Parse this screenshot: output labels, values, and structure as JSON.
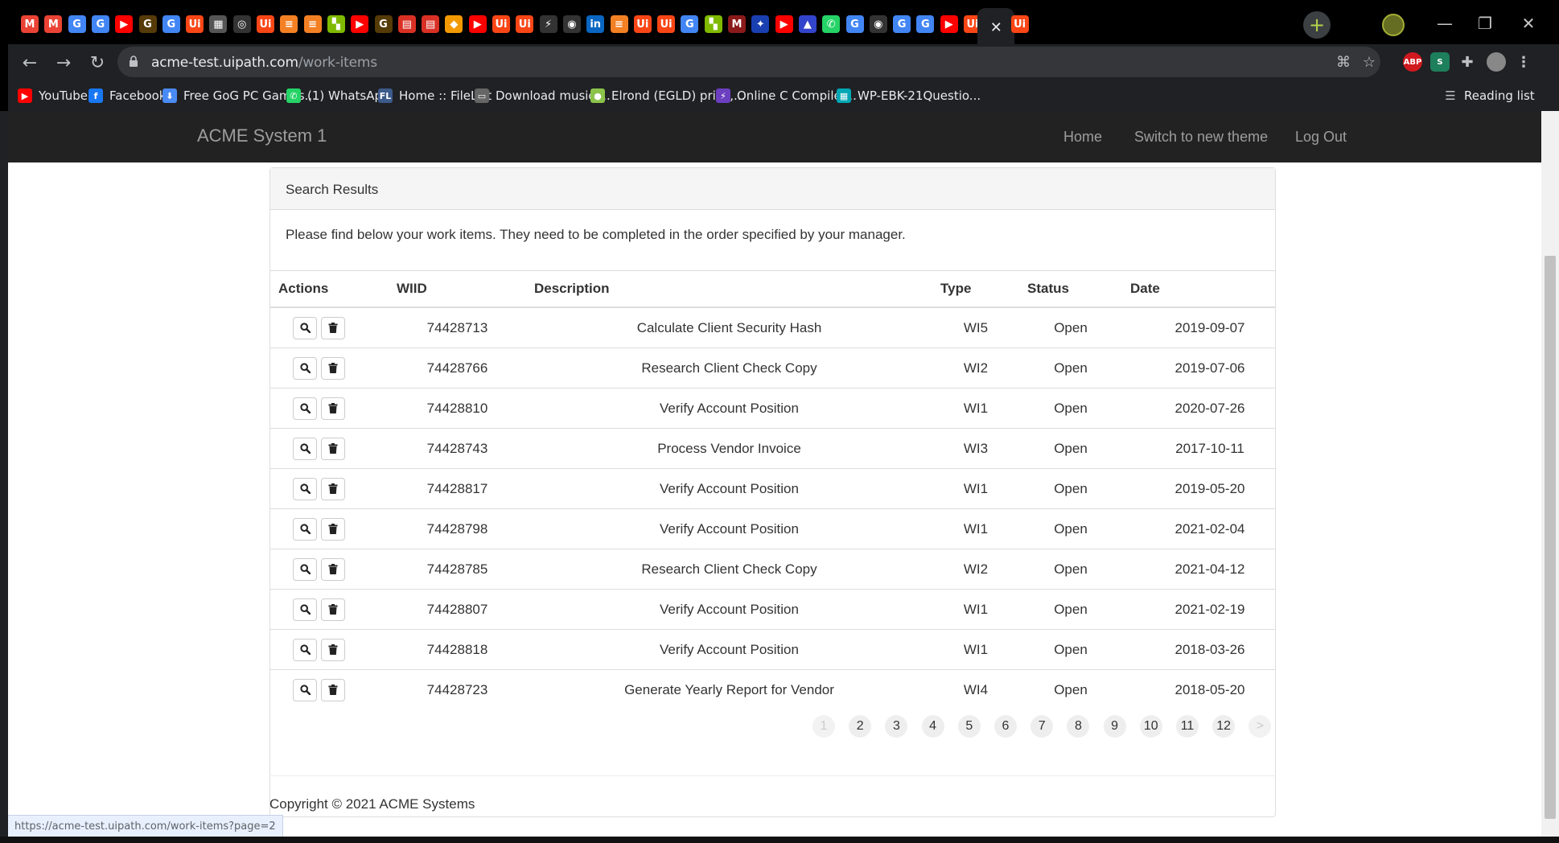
{
  "browser": {
    "tabs": [
      {
        "icon": "gmail-icon",
        "glyph": "M",
        "color": "#ea4335"
      },
      {
        "icon": "gmail-icon",
        "glyph": "M",
        "color": "#ea4335"
      },
      {
        "icon": "google-icon",
        "glyph": "G",
        "color": "#4285f4"
      },
      {
        "icon": "google-icon",
        "glyph": "G",
        "color": "#4285f4"
      },
      {
        "icon": "youtube-icon",
        "glyph": "▶",
        "color": "#ff0000"
      },
      {
        "icon": "goodreads-icon",
        "glyph": "G",
        "color": "#553b08"
      },
      {
        "icon": "google-icon",
        "glyph": "G",
        "color": "#4285f4"
      },
      {
        "icon": "uipath-icon",
        "glyph": "Ui",
        "color": "#fa4616"
      },
      {
        "icon": "calculator-icon",
        "glyph": "▦",
        "color": "#555555"
      },
      {
        "icon": "chatgpt-icon",
        "glyph": "◎",
        "color": "#333333"
      },
      {
        "icon": "uipath-icon",
        "glyph": "Ui",
        "color": "#fa4616"
      },
      {
        "icon": "stackoverflow-icon",
        "glyph": "≡",
        "color": "#f48024"
      },
      {
        "icon": "stackoverflow-icon",
        "glyph": "≡",
        "color": "#f48024"
      },
      {
        "icon": "microsoft-icon",
        "glyph": "▚",
        "color": "#7fba00"
      },
      {
        "icon": "youtube-icon",
        "glyph": "▶",
        "color": "#ff0000"
      },
      {
        "icon": "goodreads-icon",
        "glyph": "G",
        "color": "#553b08"
      },
      {
        "icon": "store-icon",
        "glyph": "▤",
        "color": "#d93025"
      },
      {
        "icon": "store-icon",
        "glyph": "▤",
        "color": "#d93025"
      },
      {
        "icon": "diamond-icon",
        "glyph": "◆",
        "color": "#f29900"
      },
      {
        "icon": "youtube-icon",
        "glyph": "▶",
        "color": "#ff0000"
      },
      {
        "icon": "uipath-icon",
        "glyph": "Ui",
        "color": "#fa4616"
      },
      {
        "icon": "uipath-icon",
        "glyph": "Ui",
        "color": "#fa4616"
      },
      {
        "icon": "bolt-icon",
        "glyph": "⚡",
        "color": "#333333"
      },
      {
        "icon": "github-icon",
        "glyph": "◉",
        "color": "#333333"
      },
      {
        "icon": "linkedin-icon",
        "glyph": "in",
        "color": "#0a66c2"
      },
      {
        "icon": "stackoverflow-icon",
        "glyph": "≡",
        "color": "#f48024"
      },
      {
        "icon": "uipath-icon",
        "glyph": "Ui",
        "color": "#fa4616"
      },
      {
        "icon": "uipath-icon",
        "glyph": "Ui",
        "color": "#fa4616"
      },
      {
        "icon": "google-icon",
        "glyph": "G",
        "color": "#4285f4"
      },
      {
        "icon": "microsoft-icon",
        "glyph": "▚",
        "color": "#7fba00"
      },
      {
        "icon": "mailchimp-icon",
        "glyph": "M",
        "color": "#8b1a1a"
      },
      {
        "icon": "bolt-icon",
        "glyph": "✦",
        "color": "#1a3fb0"
      },
      {
        "icon": "youtube-icon",
        "glyph": "▶",
        "color": "#ff0000"
      },
      {
        "icon": "triangle-icon",
        "glyph": "▲",
        "color": "#3344cc"
      },
      {
        "icon": "whatsapp-icon",
        "glyph": "✆",
        "color": "#25d366"
      },
      {
        "icon": "google-icon",
        "glyph": "G",
        "color": "#4285f4"
      },
      {
        "icon": "github-icon",
        "glyph": "◉",
        "color": "#333333"
      },
      {
        "icon": "google-icon",
        "glyph": "G",
        "color": "#4285f4"
      },
      {
        "icon": "google-icon",
        "glyph": "G",
        "color": "#4285f4"
      },
      {
        "icon": "youtube-icon",
        "glyph": "▶",
        "color": "#ff0000"
      },
      {
        "icon": "uipath-icon",
        "glyph": "Ui",
        "color": "#fa4616"
      },
      {
        "icon": "close-icon",
        "glyph": "✕",
        "color": "#e8eaed",
        "active": true
      },
      {
        "icon": "uipath-icon",
        "glyph": "Ui",
        "color": "#fa4616"
      }
    ],
    "url_host": "acme-test.uipath.com",
    "url_path": "/work-items",
    "bookmarks": [
      {
        "label": "YouTube",
        "icon": "youtube-icon",
        "glyph": "▶",
        "color": "#ff0000"
      },
      {
        "label": "Facebook",
        "icon": "facebook-icon",
        "glyph": "f",
        "color": "#1877f2"
      },
      {
        "label": "Free GoG PC Games...",
        "icon": "download-icon",
        "glyph": "⬇",
        "color": "#4a8af4"
      },
      {
        "label": "(1) WhatsApp",
        "icon": "whatsapp-icon",
        "glyph": "✆",
        "color": "#25d366"
      },
      {
        "label": "Home :: FileList",
        "icon": "filelist-icon",
        "glyph": "FL",
        "color": "#3c5a8a"
      },
      {
        "label": "Download music,...",
        "icon": "monitor-icon",
        "glyph": "▭",
        "color": "#666666"
      },
      {
        "label": "Elrond (EGLD) price,...",
        "icon": "coin-icon",
        "glyph": "●",
        "color": "#8bc34a"
      },
      {
        "label": "Online C Compiler...",
        "icon": "bolt-icon",
        "glyph": "⚡",
        "color": "#6b3fc0"
      },
      {
        "label": "WP-EBK-21Questio...",
        "icon": "grid-icon",
        "glyph": "▦",
        "color": "#00a6b4"
      }
    ],
    "reading_list": "Reading list",
    "status_url": "https://acme-test.uipath.com/work-items?page=2"
  },
  "site": {
    "brand": "ACME System 1",
    "nav": [
      "Home",
      "Switch to new theme",
      "Log Out"
    ]
  },
  "panel": {
    "heading": "Search Results",
    "intro": "Please find below your work items. They need to be completed in the order specified by your manager.",
    "columns": [
      "Actions",
      "WIID",
      "Description",
      "Type",
      "Status",
      "Date"
    ],
    "rows": [
      {
        "wiid": "74428713",
        "description": "Calculate Client Security Hash",
        "type": "WI5",
        "status": "Open",
        "date": "2019-09-07"
      },
      {
        "wiid": "74428766",
        "description": "Research Client Check Copy",
        "type": "WI2",
        "status": "Open",
        "date": "2019-07-06"
      },
      {
        "wiid": "74428810",
        "description": "Verify Account Position",
        "type": "WI1",
        "status": "Open",
        "date": "2020-07-26"
      },
      {
        "wiid": "74428743",
        "description": "Process Vendor Invoice",
        "type": "WI3",
        "status": "Open",
        "date": "2017-10-11"
      },
      {
        "wiid": "74428817",
        "description": "Verify Account Position",
        "type": "WI1",
        "status": "Open",
        "date": "2019-05-20"
      },
      {
        "wiid": "74428798",
        "description": "Verify Account Position",
        "type": "WI1",
        "status": "Open",
        "date": "2021-02-04"
      },
      {
        "wiid": "74428785",
        "description": "Research Client Check Copy",
        "type": "WI2",
        "status": "Open",
        "date": "2021-04-12"
      },
      {
        "wiid": "74428807",
        "description": "Verify Account Position",
        "type": "WI1",
        "status": "Open",
        "date": "2021-02-19"
      },
      {
        "wiid": "74428818",
        "description": "Verify Account Position",
        "type": "WI1",
        "status": "Open",
        "date": "2018-03-26"
      },
      {
        "wiid": "74428723",
        "description": "Generate Yearly Report for Vendor",
        "type": "WI4",
        "status": "Open",
        "date": "2018-05-20"
      }
    ]
  },
  "pagination": {
    "pages": [
      "1",
      "2",
      "3",
      "4",
      "5",
      "6",
      "7",
      "8",
      "9",
      "10",
      "11",
      "12"
    ],
    "current": "1",
    "next": ">"
  },
  "footer": {
    "copyright": "Copyright © 2021 ACME Systems"
  },
  "colors": {
    "navbar_bg": "#222222",
    "nav_text": "#9d9d9d",
    "panel_border": "#dddddd",
    "panel_heading_bg": "#f5f5f5"
  }
}
